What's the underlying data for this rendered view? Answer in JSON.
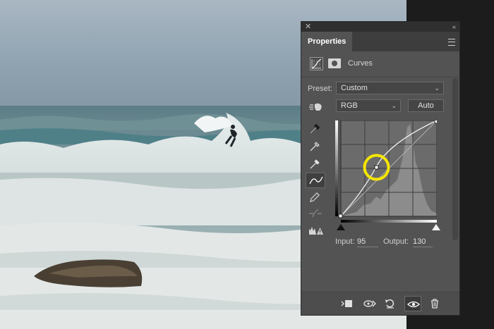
{
  "panel": {
    "tab": "Properties",
    "title": "Curves",
    "preset_label": "Preset:",
    "preset_value": "Custom",
    "channel_value": "RGB",
    "auto_label": "Auto",
    "input_label": "Input:",
    "input_value": "95",
    "output_label": "Output:",
    "output_value": "130"
  },
  "colors": {
    "panel_bg": "#535353",
    "highlight_circle": "#f5e600"
  },
  "icons": {
    "close": "close-icon",
    "collapse": "collapse-icon",
    "menu": "panel-menu-icon",
    "adjustment": "curves-adjustment-icon",
    "mask": "mask-icon",
    "target_adjust": "on-image-adjust-icon",
    "eyedroppers": [
      "black-point-eyedropper-icon",
      "gray-point-eyedropper-icon",
      "white-point-eyedropper-icon"
    ],
    "curve_tool": "edit-points-curve-icon",
    "pencil": "draw-pencil-icon",
    "smooth": "smooth-curve-icon",
    "clipping": "clipping-warning-icon",
    "bottom": [
      "clip-to-layer-icon",
      "view-previous-state-icon",
      "reset-icon",
      "visibility-eye-icon",
      "delete-trash-icon"
    ]
  }
}
